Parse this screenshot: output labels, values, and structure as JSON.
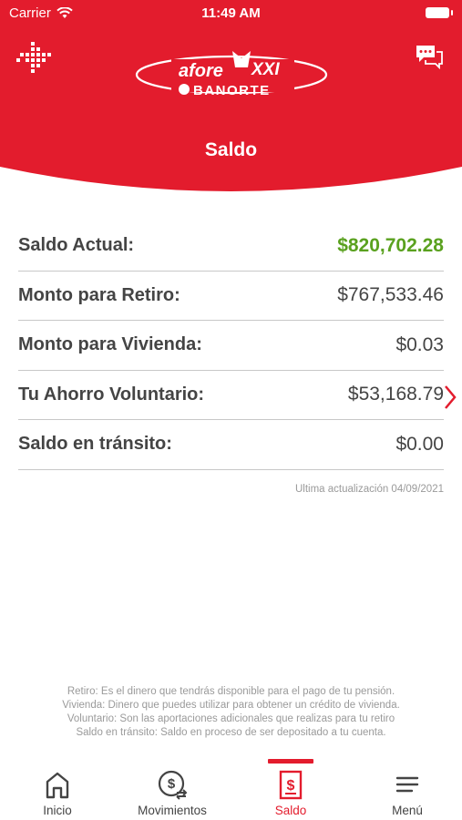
{
  "status_bar": {
    "carrier": "Carrier",
    "time": "11:49 AM"
  },
  "header": {
    "title": "Saldo",
    "logo": {
      "line1": "afore",
      "line1_suffix": "XXI",
      "line2": "BANORTE"
    },
    "brand_color": "#e31c2d"
  },
  "balances": [
    {
      "label": "Saldo Actual:",
      "value": "$820,702.28"
    },
    {
      "label": "Monto para Retiro:",
      "value": "$767,533.46"
    },
    {
      "label": "Monto para Vivienda:",
      "value": "$0.03"
    },
    {
      "label": "Tu Ahorro Voluntario:",
      "value": "$53,168.79"
    },
    {
      "label": "Saldo en tránsito:",
      "value": "$0.00"
    }
  ],
  "last_update": "Ultima actualización 04/09/2021",
  "glossary": [
    "Retiro: Es el dinero que tendrás disponible para el pago de tu pensión.",
    "Vivienda: Dinero que puedes utilizar para obtener un crédito de vivienda.",
    "Voluntario: Son las aportaciones adicionales que realizas para tu retiro",
    "Saldo en tránsito: Saldo en proceso de ser depositado a tu cuenta."
  ],
  "tabs": [
    {
      "label": "Inicio",
      "icon": "home-icon"
    },
    {
      "label": "Movimientos",
      "icon": "money-exchange-icon"
    },
    {
      "label": "Saldo",
      "icon": "balance-document-icon"
    },
    {
      "label": "Menú",
      "icon": "hamburger-menu-icon"
    }
  ],
  "colors": {
    "accent": "#e31c2d",
    "positive": "#5aa11f",
    "text": "#444444",
    "muted": "#9a9a9a"
  }
}
